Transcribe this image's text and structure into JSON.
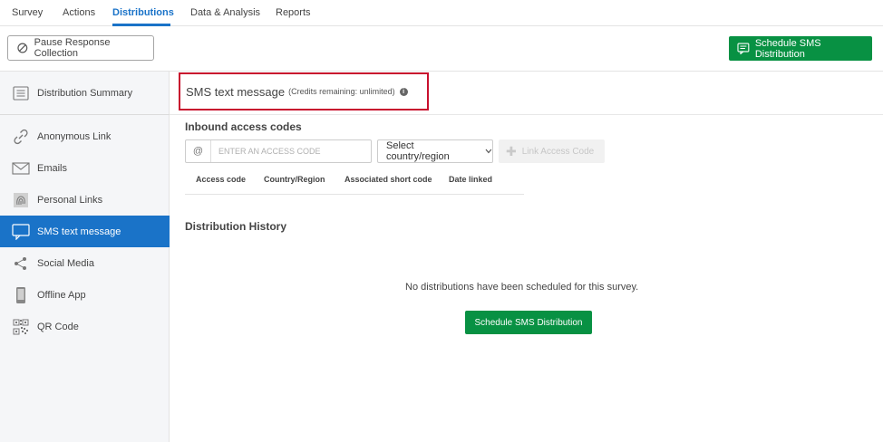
{
  "nav": {
    "tabs": [
      {
        "label": "Survey"
      },
      {
        "label": "Actions"
      },
      {
        "label": "Distributions"
      },
      {
        "label": "Data & Analysis"
      },
      {
        "label": "Reports"
      }
    ],
    "active_tab": "Distributions",
    "accent_color": "#1a73c8"
  },
  "toolbar": {
    "pause_label": "Pause Response Collection",
    "schedule_label": "Schedule SMS Distribution",
    "schedule_color": "#089143"
  },
  "sidebar": {
    "items": [
      {
        "label": "Distribution Summary",
        "icon": "list-icon"
      },
      {
        "label": "Anonymous Link",
        "icon": "link-icon"
      },
      {
        "label": "Emails",
        "icon": "envelope-icon"
      },
      {
        "label": "Personal Links",
        "icon": "fingerprint-icon"
      },
      {
        "label": "SMS text message",
        "icon": "chat-bubble-icon"
      },
      {
        "label": "Social Media",
        "icon": "share-icon"
      },
      {
        "label": "Offline App",
        "icon": "phone-icon"
      },
      {
        "label": "QR Code",
        "icon": "qr-code-icon"
      }
    ],
    "active_item": "SMS text message"
  },
  "main": {
    "title": "SMS text message",
    "credits": "(Credits remaining: unlimited)",
    "highlight_color": "#c8102e",
    "inbound": {
      "title": "Inbound access codes",
      "at_symbol": "@",
      "code_placeholder": "ENTER AN ACCESS CODE",
      "country_select": "Select country/region",
      "link_button": "Link Access Code",
      "columns": [
        "Access code",
        "Country/Region",
        "Associated short code",
        "Date linked"
      ]
    },
    "history": {
      "title": "Distribution History",
      "empty_message": "No distributions have been scheduled for this survey.",
      "schedule_label": "Schedule SMS Distribution"
    }
  }
}
